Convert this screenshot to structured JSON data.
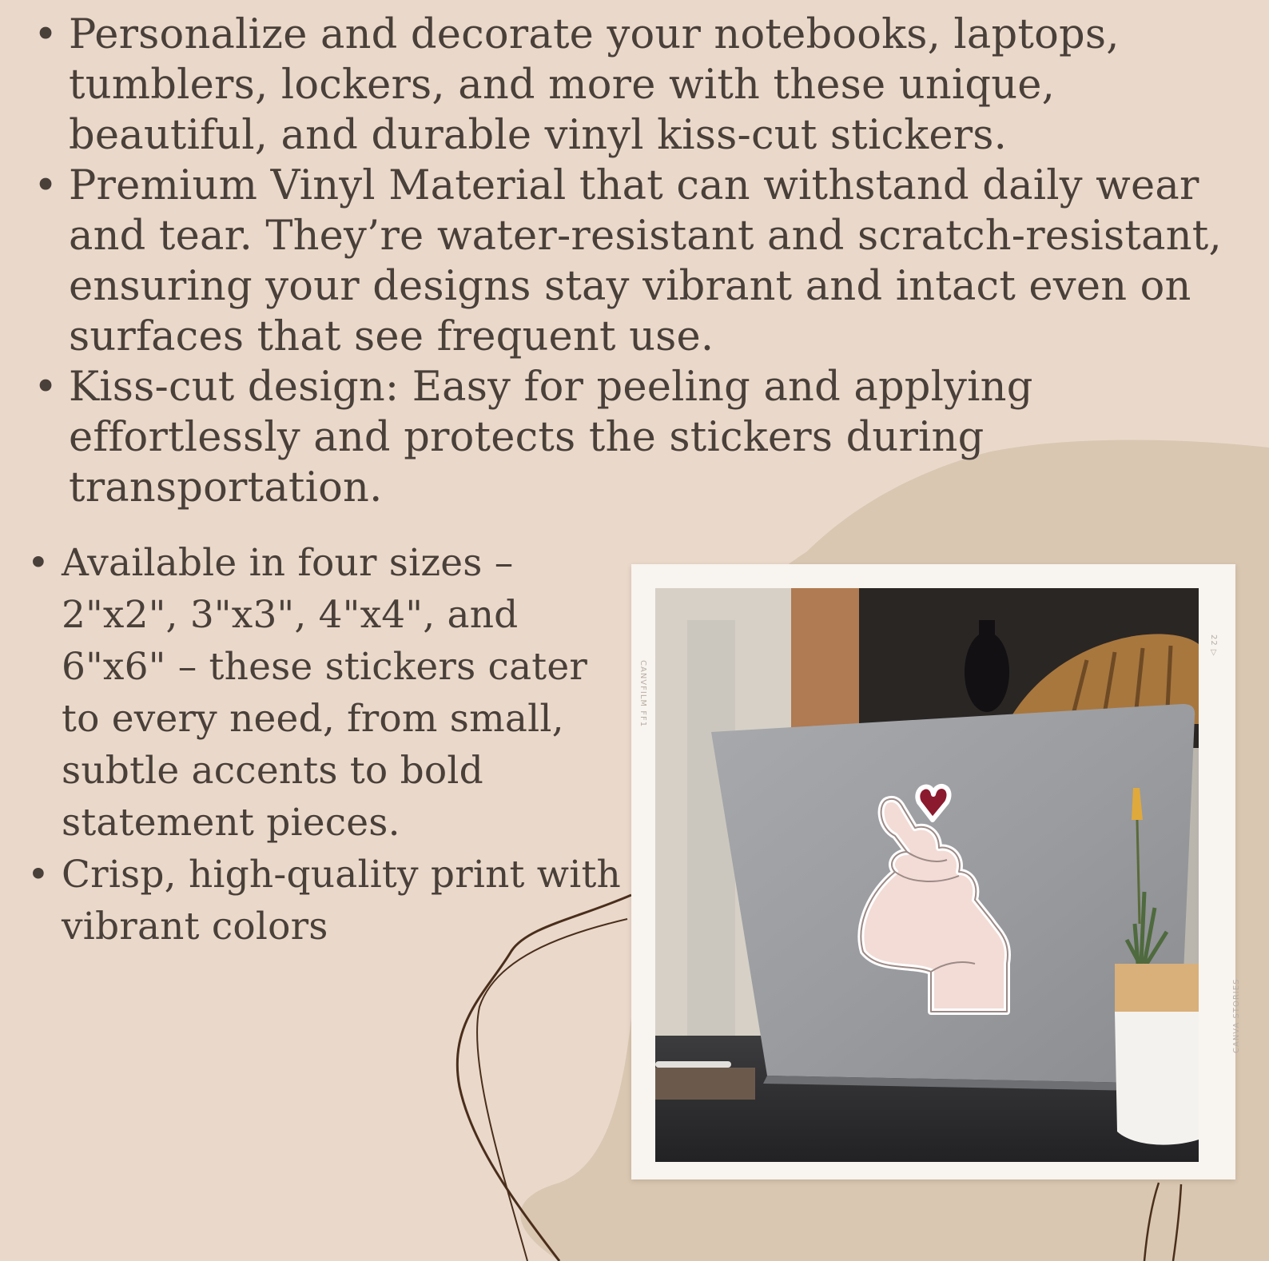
{
  "top_bullets": [
    "Personalize and decorate your notebooks, laptops, tumblers, lockers, and more with these unique, beautiful, and durable vinyl kiss-cut stickers.",
    "Premium Vinyl Material that can withstand daily wear and tear. They’re water-resistant and scratch-resistant, ensuring your designs stay vibrant and intact even on surfaces that see frequent use.",
    "Kiss-cut design: Easy for peeling and applying effortlessly and protects the stickers during transportation."
  ],
  "bottom_bullets": [
    "Available in four sizes – 2\"x2\", 3\"x3\", 4\"x4\", and 6\"x6\" – these stickers cater to every need, from small, subtle accents to bold statement pieces.",
    "Crisp, high-quality print with vibrant colors"
  ],
  "bullet_glyph": "•",
  "film_strip": {
    "left_label": "CANVFILM FF1",
    "right_label": "CANVA STORIES",
    "frame_number": "22 ▷"
  },
  "colors": {
    "background": "#ead9ca",
    "blob": "#d9c7b2",
    "text": "#4a403a",
    "frame": "#f8f4ef",
    "heart": "#8b1a2e",
    "squiggle": "#4a2e1c"
  },
  "icons": {
    "sticker": "finger-heart-sticker-icon"
  }
}
